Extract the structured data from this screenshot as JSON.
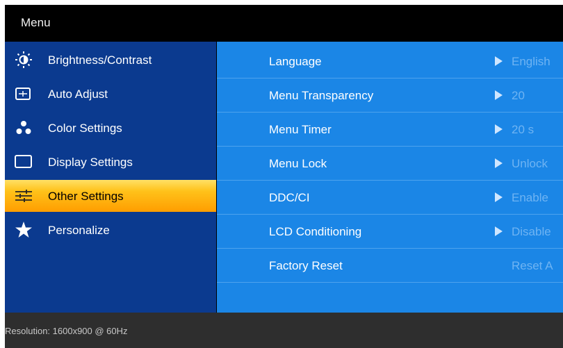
{
  "title": "Menu",
  "sidebar": {
    "items": [
      {
        "label": "Brightness/Contrast",
        "icon": "brightness-icon"
      },
      {
        "label": "Auto Adjust",
        "icon": "auto-adjust-icon"
      },
      {
        "label": "Color Settings",
        "icon": "color-settings-icon"
      },
      {
        "label": "Display Settings",
        "icon": "display-settings-icon"
      },
      {
        "label": "Other Settings",
        "icon": "other-settings-icon",
        "selected": true
      },
      {
        "label": "Personalize",
        "icon": "star-icon"
      }
    ]
  },
  "settings": {
    "rows": [
      {
        "name": "Language",
        "value": "English"
      },
      {
        "name": "Menu Transparency",
        "value": "20"
      },
      {
        "name": "Menu Timer",
        "value": "20 s"
      },
      {
        "name": "Menu Lock",
        "value": "Unlock"
      },
      {
        "name": "DDC/CI",
        "value": "Enable"
      },
      {
        "name": "LCD Conditioning",
        "value": "Disable"
      },
      {
        "name": "Factory Reset",
        "value": "Reset A"
      }
    ]
  },
  "footer": {
    "resolution": "Resolution:  1600x900 @ 60Hz"
  },
  "colors": {
    "left_panel": "#0b3a8f",
    "right_panel": "#1b86e6",
    "selected": "#ffb000",
    "value_text": "#6fb4f3",
    "footer": "#2e2e2e"
  }
}
